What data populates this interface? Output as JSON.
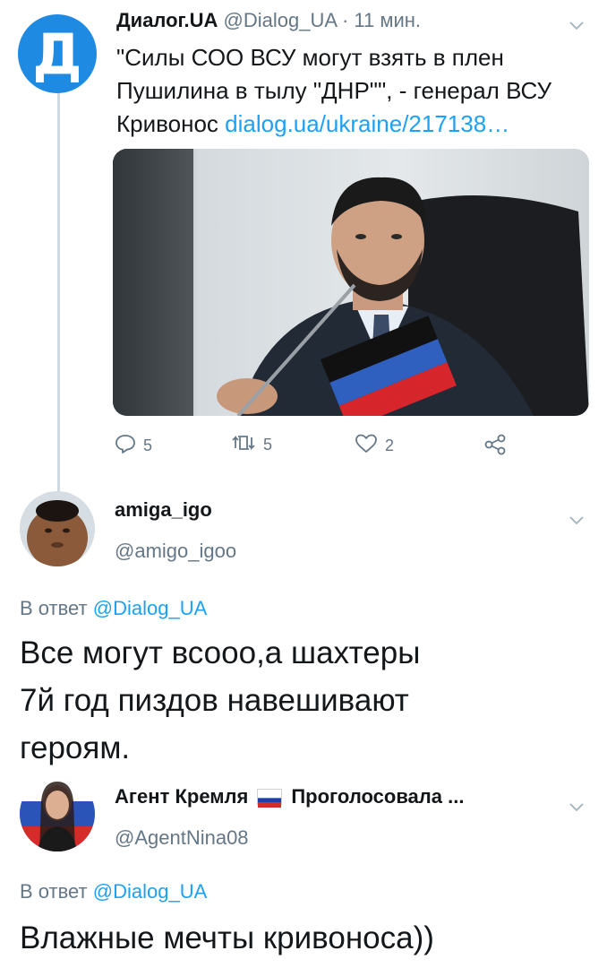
{
  "tweet1": {
    "avatar_letter": "Д",
    "display_name": "Диалог.UA",
    "handle": "@Dialog_UA",
    "separator": "·",
    "time": "11 мин.",
    "text": "\"Силы СОО ВСУ могут взять в плен Пушилина в тылу \"ДНР\"\", - генерал ВСУ Кривонос",
    "link": "dialog.ua/ukraine/217138…",
    "actions": {
      "reply_count": "5",
      "retweet_count": "5",
      "like_count": "2"
    }
  },
  "tweet2": {
    "display_name": "amiga_igo",
    "handle": "@amigo_igoo",
    "reply_prefix": "В ответ",
    "reply_handle": "@Dialog_UA",
    "text_line1": "Все могут всооо,а шахтеры",
    "text_line2": "7й год пиздов навешивают",
    "text_line3": "героям."
  },
  "tweet3": {
    "display_name": "Агент Кремля",
    "display_name_suffix": "Проголосовала ...",
    "handle": "@AgentNina08",
    "reply_prefix": "В ответ",
    "reply_handle": "@Dialog_UA",
    "text": "Влажные мечты кривоноса))"
  },
  "colors": {
    "accent": "#1da1f2",
    "muted": "#657786",
    "text": "#14171a",
    "avatar_dialog": "#1f8ae2"
  },
  "icons": [
    "chevron-down-icon",
    "reply-icon",
    "retweet-icon",
    "like-icon",
    "share-icon",
    "russia-flag-icon"
  ]
}
